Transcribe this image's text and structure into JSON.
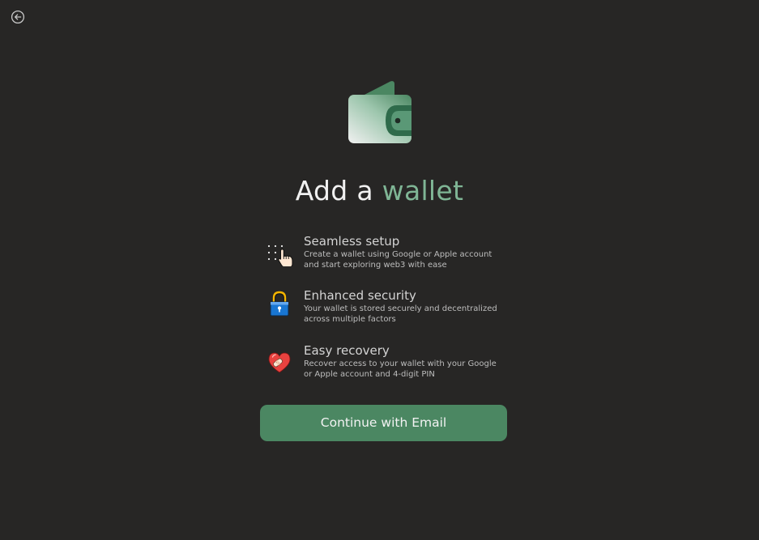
{
  "icons": {
    "back": "back-arrow-circle-icon",
    "hero": "wallet-icon"
  },
  "title": {
    "part1": "Add a",
    "part2": "wallet"
  },
  "features": [
    {
      "icon": "keypad-tap-icon",
      "title": "Seamless setup",
      "line1": "Create a wallet using Google or Apple account",
      "line2": "and start exploring web3 with ease"
    },
    {
      "icon": "padlock-icon",
      "title": "Enhanced security",
      "line1": "Your wallet is stored securely and decentralized",
      "line2": "across multiple factors"
    },
    {
      "icon": "heart-bandage-icon",
      "title": "Easy recovery",
      "line1": "Recover access to your wallet  with your Google",
      "line2": "or Apple account and 4-digit PIN"
    }
  ],
  "cta": {
    "label": "Continue with Email"
  },
  "colors": {
    "background": "#272625",
    "accent": "#7fb595",
    "button": "#4b8762"
  }
}
